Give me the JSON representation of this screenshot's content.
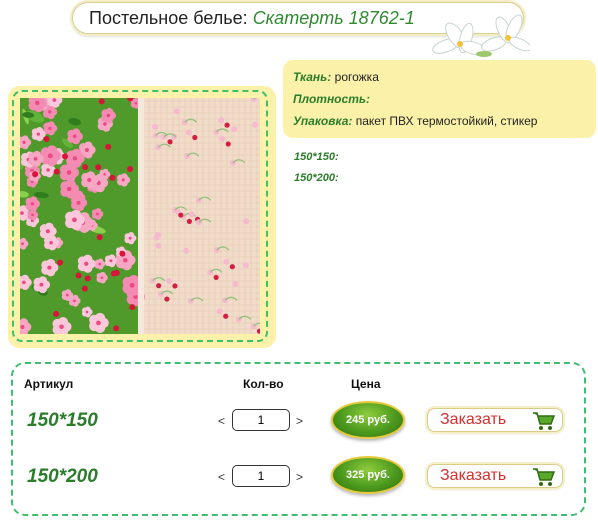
{
  "header": {
    "category": "Постельное белье:",
    "product": "Скатерть 18762-1"
  },
  "info": {
    "fabric_key": "Ткань:",
    "fabric_value": "рогожка",
    "density_key": "Плотность:",
    "density_value": "",
    "packaging_key": "Упаковка:",
    "packaging_value": "пакет ПВХ термостойкий, стикер"
  },
  "sizes_list": [
    "150*150:",
    "150*200:"
  ],
  "table": {
    "col_article": "Артикул",
    "col_qty": "Кол-во",
    "col_price": "Цена",
    "rows": [
      {
        "size": "150*150",
        "qty": "1",
        "price": "245 руб.",
        "order_label": "Заказать",
        "dec": "<",
        "inc": ">"
      },
      {
        "size": "150*200",
        "qty": "1",
        "price": "325 руб.",
        "order_label": "Заказать",
        "dec": "<",
        "inc": ">"
      }
    ]
  },
  "colors": {
    "accent_green": "#2b7d2b",
    "panel_yellow": "#fbf1a8",
    "dashed_border": "#3fbf6d",
    "order_text": "#d63030"
  },
  "icons": [
    "white-lily-flowers-icon",
    "shopping-cart-icon"
  ]
}
